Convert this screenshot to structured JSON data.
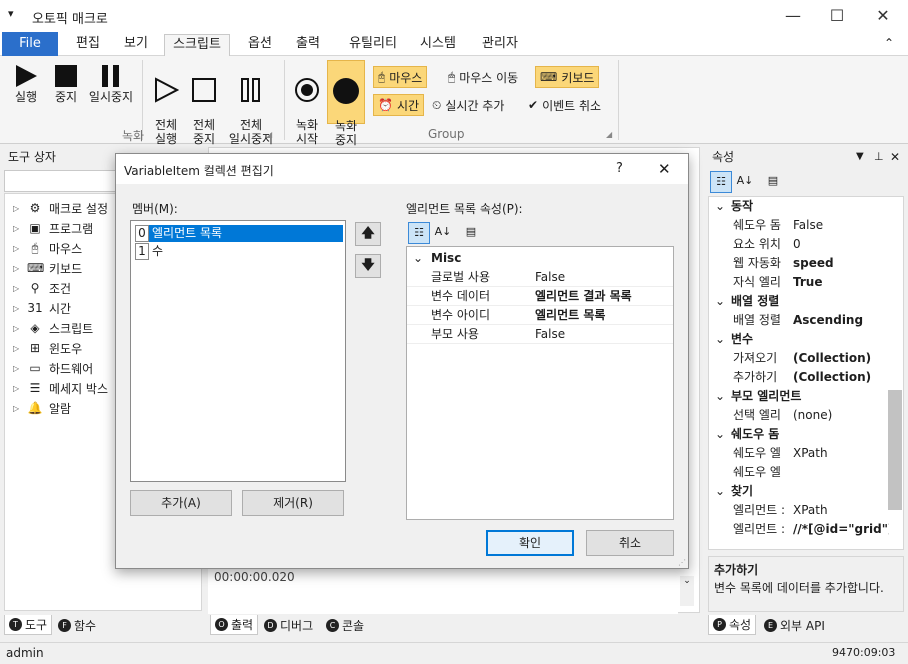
{
  "app": {
    "title": "오토픽 매크로",
    "quick_menu_icon": "▾"
  },
  "window_controls": {
    "minimize": "—",
    "maximize": "☐",
    "close": "✕"
  },
  "ribbon_tabs": [
    "File",
    "편집",
    "보기",
    "스크립트",
    "옵션",
    "출력",
    "유틸리티",
    "시스템",
    "관리자"
  ],
  "ribbon": {
    "run_group_label": "녹화",
    "group_label": "Group",
    "run": "실행",
    "stop": "중지",
    "pause": "일시중지",
    "all_run": "전체\n실행",
    "all_stop": "전체\n중지",
    "all_pause": "전체\n일시중지",
    "rec_start": "녹화\n시작",
    "rec_stop": "녹화\n중지",
    "mouse": "마우스",
    "mouse_move": "마우스 이동",
    "keyboard": "키보드",
    "time": "시간",
    "realtime_add": "실시간 추가",
    "event_cancel": "이벤트 취소",
    "collapse_icon": "⌃"
  },
  "left_panel": {
    "title": "도구 상자",
    "items": [
      {
        "label": "매크로 설정",
        "icon": "⚙"
      },
      {
        "label": "프로그램",
        "icon": "▣"
      },
      {
        "label": "마우스",
        "icon": "🖰"
      },
      {
        "label": "키보드",
        "icon": "⌨"
      },
      {
        "label": "조건",
        "icon": "⚲"
      },
      {
        "label": "시간",
        "icon": "31"
      },
      {
        "label": "스크립트",
        "icon": "◈"
      },
      {
        "label": "윈도우",
        "icon": "⊞"
      },
      {
        "label": "하드웨어",
        "icon": "▭"
      },
      {
        "label": "메세지 박스",
        "icon": "☰"
      },
      {
        "label": "알람",
        "icon": "🔔"
      }
    ],
    "tabs": [
      {
        "label": "도구",
        "badge": "T"
      },
      {
        "label": "함수",
        "badge": "F"
      }
    ]
  },
  "center": {
    "output_text": "00:00:00.020",
    "tabs": [
      {
        "label": "출력",
        "badge": "O"
      },
      {
        "label": "디버그",
        "badge": "D"
      },
      {
        "label": "콘솔",
        "badge": "C"
      }
    ]
  },
  "right_panel": {
    "title": "속성",
    "pin": "↓  ✕",
    "sections": [
      {
        "name": "동작",
        "rows": [
          {
            "k": "쉐도우 돔",
            "v": "False",
            "bold": false
          },
          {
            "k": "요소 위치",
            "v": "0",
            "bold": false
          },
          {
            "k": "웹 자동화",
            "v": "speed",
            "bold": true
          },
          {
            "k": "자식 엘리",
            "v": "True",
            "bold": true
          }
        ]
      },
      {
        "name": "배열 정렬",
        "rows": [
          {
            "k": "배열 정렬",
            "v": "Ascending",
            "bold": true
          }
        ]
      },
      {
        "name": "변수",
        "rows": [
          {
            "k": "가져오기",
            "v": "(Collection)",
            "bold": true
          },
          {
            "k": "추가하기",
            "v": "(Collection)",
            "bold": true
          }
        ]
      },
      {
        "name": "부모 엘리먼트",
        "rows": [
          {
            "k": "선택 엘리",
            "v": "(none)",
            "bold": false
          }
        ]
      },
      {
        "name": "쉐도우 돔",
        "rows": [
          {
            "k": "쉐도우 엘",
            "v": "XPath",
            "bold": false
          },
          {
            "k": "쉐도우 엘",
            "v": "",
            "bold": false
          }
        ]
      },
      {
        "name": "찾기",
        "rows": [
          {
            "k": "엘리먼트 :",
            "v": "XPath",
            "bold": false
          },
          {
            "k": "엘리먼트 :",
            "v": "//*[@id=\"grid\"]",
            "bold": true
          }
        ]
      }
    ],
    "desc_title": "추가하기",
    "desc_text": "변수 목록에 데이터를 추가합니다.",
    "tabs": [
      {
        "label": "속성",
        "badge": "P"
      },
      {
        "label": "외부 API",
        "badge": "E"
      }
    ]
  },
  "status": {
    "user": "admin",
    "time": "9470:09:03"
  },
  "dialog": {
    "title": "VariableItem 컬렉션 편집기",
    "help": "?",
    "close": "✕",
    "members_label": "멤버(M):",
    "members": [
      {
        "index": "0",
        "name": "엘리먼트 목록"
      },
      {
        "index": "1",
        "name": "수"
      }
    ],
    "props_label": "엘리먼트 목록 속성(P):",
    "category": "Misc",
    "props": [
      {
        "k": "글로벌 사용",
        "v": "False",
        "bold": false
      },
      {
        "k": "변수 데이터",
        "v": "엘리먼트 결과 목록",
        "bold": true
      },
      {
        "k": "변수 아이디",
        "v": "엘리먼트 목록",
        "bold": true
      },
      {
        "k": "부모 사용",
        "v": "False",
        "bold": false
      }
    ],
    "add_button": "추가(A)",
    "remove_button": "제거(R)",
    "ok_button": "확인",
    "cancel_button": "취소",
    "up_arrow": "🡅",
    "down_arrow": "🡇"
  }
}
